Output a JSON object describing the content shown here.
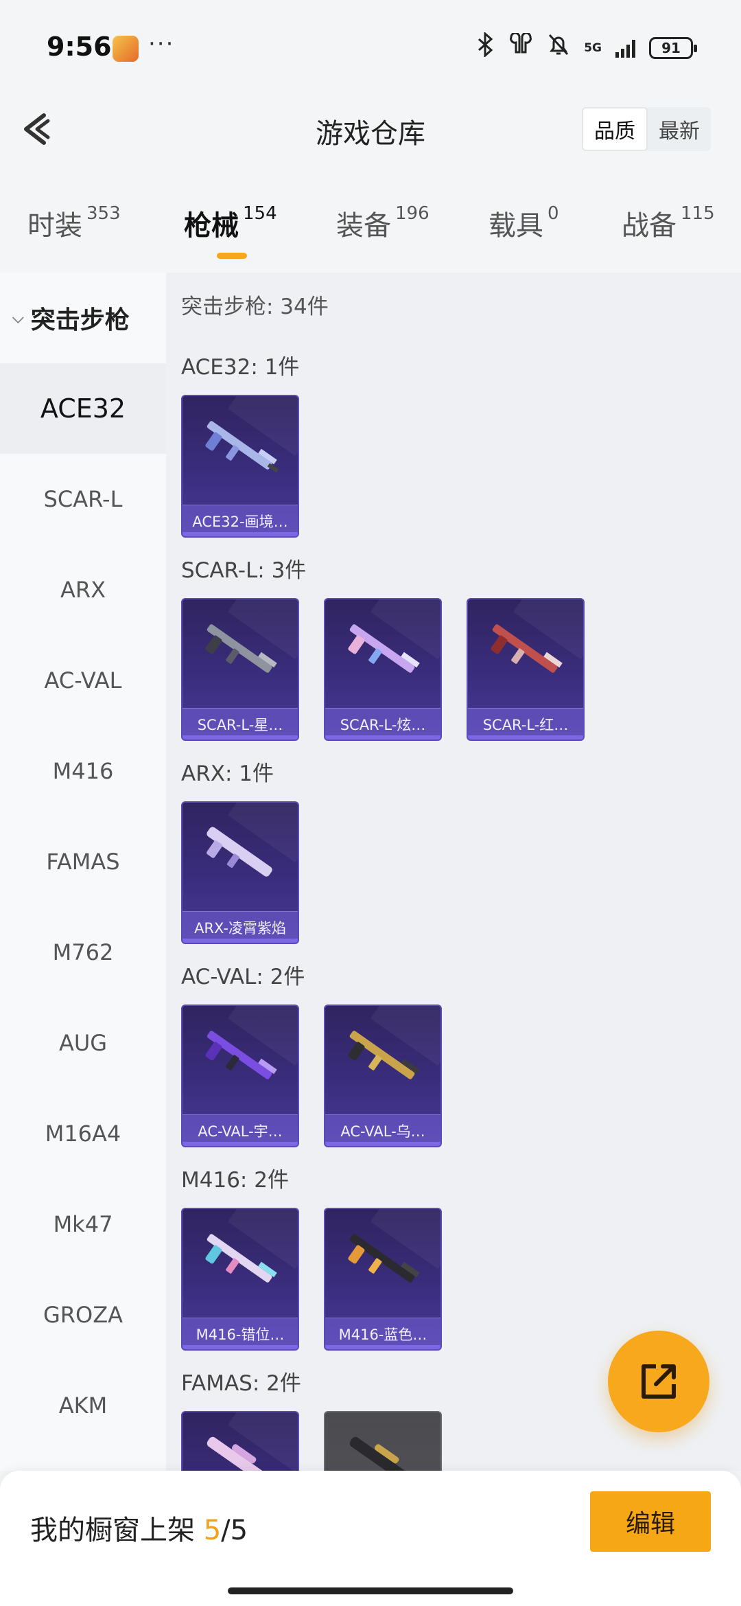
{
  "status_bar": {
    "time": "9:56",
    "battery": "91",
    "network": "5G"
  },
  "header": {
    "title": "游戏仓库",
    "sort_options": [
      "品质",
      "最新"
    ],
    "active_sort": "品质"
  },
  "tabs": [
    {
      "label": "时装",
      "count": "353"
    },
    {
      "label": "枪械",
      "count": "154",
      "active": true
    },
    {
      "label": "装备",
      "count": "196"
    },
    {
      "label": "载具",
      "count": "0"
    },
    {
      "label": "战备",
      "count": "115"
    }
  ],
  "sidebar": {
    "category": "突击步枪",
    "items": [
      "ACE32",
      "SCAR-L",
      "ARX",
      "AC-VAL",
      "M416",
      "FAMAS",
      "M762",
      "AUG",
      "M16A4",
      "Mk47",
      "GROZA",
      "AKM"
    ],
    "active": "ACE32"
  },
  "content": {
    "summary": "突击步枪: 34件",
    "groups": [
      {
        "title": "ACE32: 1件",
        "items": [
          "ACE32-画境…"
        ]
      },
      {
        "title": "SCAR-L: 3件",
        "items": [
          "SCAR-L-星…",
          "SCAR-L-炫…",
          "SCAR-L-红…"
        ]
      },
      {
        "title": "ARX: 1件",
        "items": [
          "ARX-凌霄紫焰"
        ]
      },
      {
        "title": "AC-VAL: 2件",
        "items": [
          "AC-VAL-宇…",
          "AC-VAL-乌…"
        ]
      },
      {
        "title": "M416: 2件",
        "items": [
          "M416-错位…",
          "M416-蓝色…"
        ]
      },
      {
        "title": "FAMAS: 2件",
        "items": [
          "",
          ""
        ]
      }
    ]
  },
  "bottom_bar": {
    "label": "我的橱窗上架",
    "current": "5",
    "total": "/5",
    "edit_label": "编辑"
  },
  "colors": {
    "accent": "#f7a81c",
    "card_bg": "#3a2d7d",
    "card_border": "#5b4bb5"
  },
  "icons": {
    "back": "chevron-left-icon",
    "share": "external-link-icon"
  }
}
